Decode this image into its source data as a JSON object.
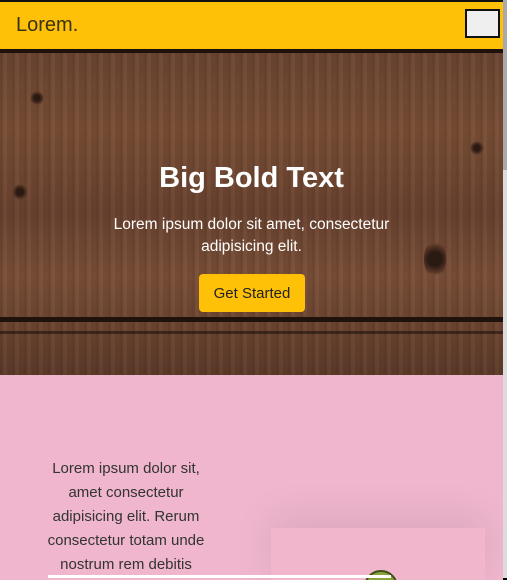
{
  "navbar": {
    "brand": "Lorem.",
    "toggle_icon": "hamburger-icon"
  },
  "hero": {
    "title": "Big Bold Text",
    "text": "Lorem ipsum dolor sit amet, consectetur adipisicing elit.",
    "button_label": "Get Started"
  },
  "section": {
    "text": "Lorem ipsum dolor sit, amet consectetur adipisicing elit. Rerum consectetur totam unde nostrum rem debitis"
  },
  "colors": {
    "accent": "#ffc107",
    "section_bg": "#efb6cd",
    "wood": "#6b4632"
  }
}
